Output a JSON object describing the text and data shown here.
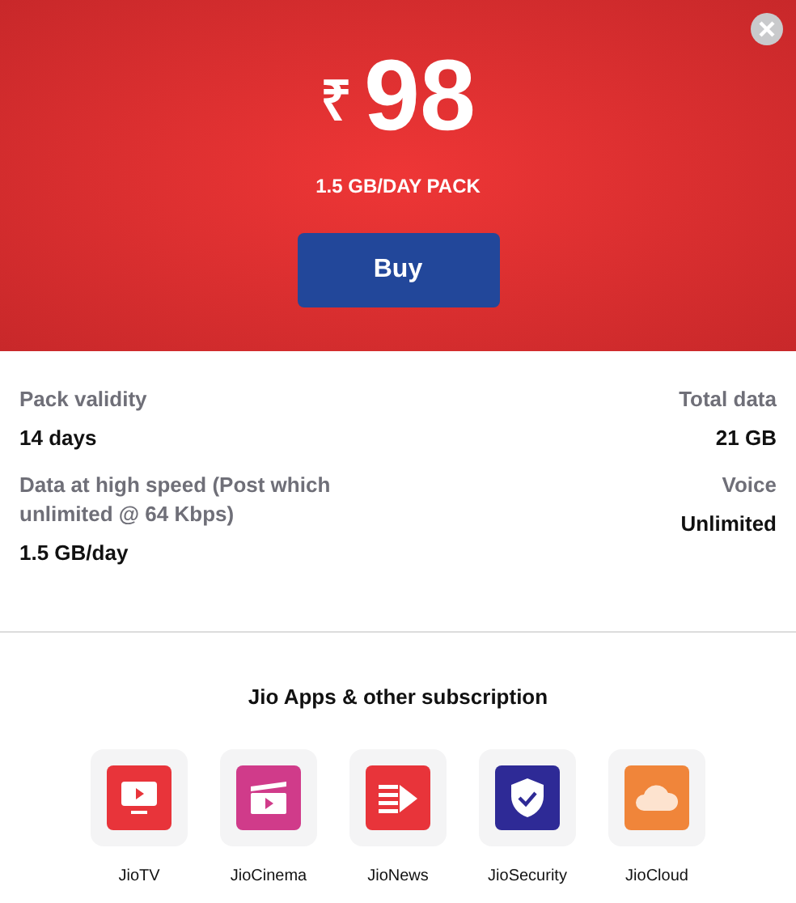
{
  "header": {
    "currency": "₹",
    "price": "98",
    "pack_name": "1.5 GB/DAY PACK",
    "buy_button": "Buy"
  },
  "details": {
    "left": [
      {
        "label": "Pack validity",
        "value": "14 days"
      },
      {
        "label": "Data at high speed (Post which unlimited @ 64 Kbps)",
        "value": "1.5 GB/day"
      }
    ],
    "right": [
      {
        "label": "Total data",
        "value": "21 GB"
      },
      {
        "label": "Voice",
        "value": "Unlimited"
      }
    ]
  },
  "apps": {
    "title": "Jio Apps & other subscription",
    "items": [
      {
        "name": "JioTV",
        "kind": "tv",
        "color": "#e8343a"
      },
      {
        "name": "JioCinema",
        "kind": "cinema",
        "color": "#d03b8a"
      },
      {
        "name": "JioNews",
        "kind": "news",
        "color": "#e8343a"
      },
      {
        "name": "JioSecurity",
        "kind": "security",
        "color": "#2e2a96"
      },
      {
        "name": "JioCloud",
        "kind": "cloud",
        "color": "#f0853a"
      }
    ]
  }
}
